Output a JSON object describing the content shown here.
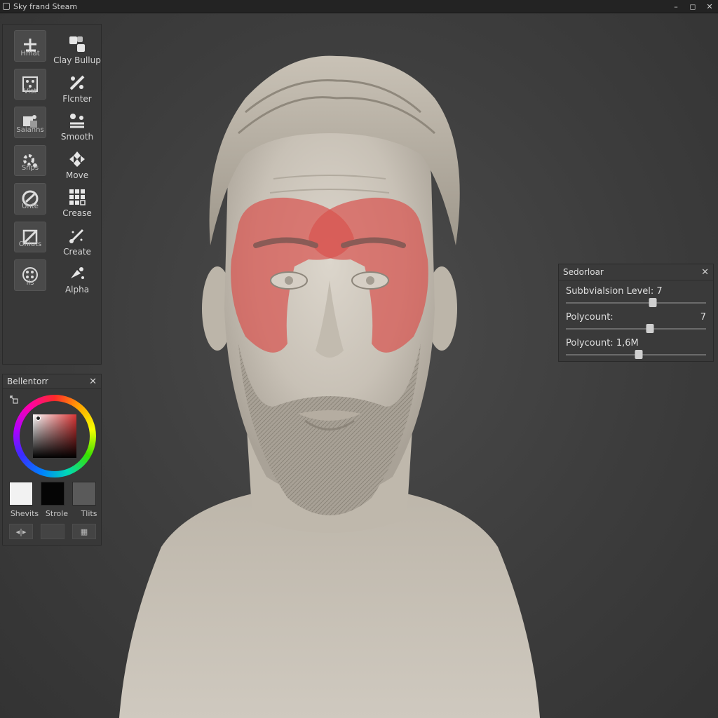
{
  "window": {
    "title": "Sky frand Steam",
    "controls": [
      "–",
      "◻",
      "✕"
    ]
  },
  "tools": {
    "left": [
      {
        "label": "Hmat",
        "icon": "grid-move-icon"
      },
      {
        "label": "Vist",
        "icon": "mask-brush-icon"
      },
      {
        "label": "Saianns",
        "icon": "standard-brush-icon"
      },
      {
        "label": "Snps",
        "icon": "snap-brush-icon"
      },
      {
        "label": "Unte",
        "icon": "inflate-brush-icon"
      },
      {
        "label": "Oniuts",
        "icon": "trim-brush-icon"
      },
      {
        "label": "Ils",
        "icon": "texture-brush-icon"
      }
    ],
    "right": [
      {
        "label": "Clay Bullup",
        "icon": "clay-buildup-icon"
      },
      {
        "label": "Flcnter",
        "icon": "flatten-icon"
      },
      {
        "label": "Smooth",
        "icon": "smooth-icon"
      },
      {
        "label": "Move",
        "icon": "move-icon"
      },
      {
        "label": "Crease",
        "icon": "crease-icon"
      },
      {
        "label": "Create",
        "icon": "create-icon"
      },
      {
        "label": "Alpha",
        "icon": "alpha-icon"
      }
    ]
  },
  "color_panel": {
    "title": "Bellentorr",
    "swatches": [
      {
        "label": "Shevits",
        "color": "#f2f2f2"
      },
      {
        "label": "Strole",
        "color": "#050505"
      },
      {
        "label": "Tlits",
        "color": "#5a5a5a"
      }
    ],
    "bottom_buttons": [
      "◂|▸",
      "",
      "▦"
    ]
  },
  "subdivision_panel": {
    "title": "Sedorloar",
    "props": [
      {
        "label": "Subbvialsion Level: 7",
        "value": "",
        "slider": 0.62
      },
      {
        "label": "Polycount:",
        "value": "7",
        "slider": 0.6
      },
      {
        "label": "Polycount: 1,6M",
        "value": "",
        "slider": 0.52
      }
    ]
  },
  "colors": {
    "accent_mask": "#d9534f",
    "clay": "#cfc9bf"
  }
}
